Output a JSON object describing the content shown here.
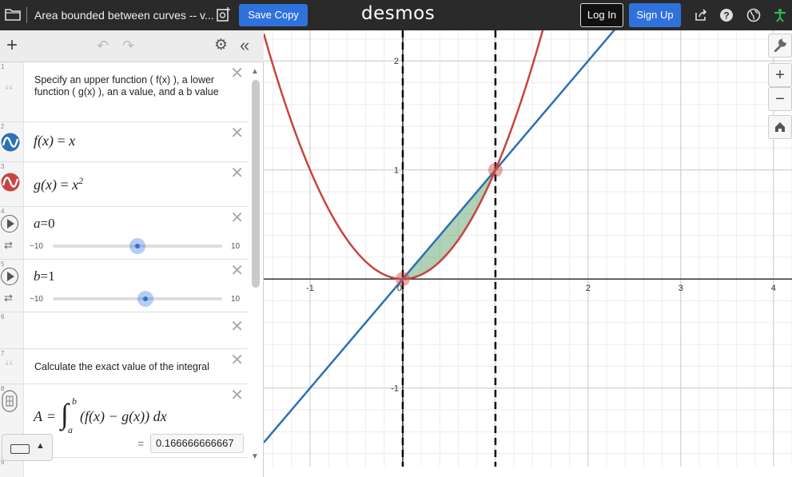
{
  "header": {
    "doc_title": "Area bounded between curves -- v...",
    "save_copy": "Save Copy",
    "logo": "desmos",
    "log_in": "Log In",
    "sign_up": "Sign Up",
    "icons": [
      "folder-icon",
      "new-doc-icon",
      "share-icon",
      "help-icon",
      "globe-icon",
      "accessibility-icon"
    ]
  },
  "toolbar": {
    "add": "+",
    "undo": "↶",
    "redo": "↷",
    "settings": "⚙",
    "collapse": "«"
  },
  "expressions": [
    {
      "index": "1",
      "type": "note",
      "text": "Specify an upper function ( f(x) ), a lower function ( g(x) ), an a value, and a b value"
    },
    {
      "index": "2",
      "type": "expression",
      "color": "#2d70b3",
      "lhs": "f(x)",
      "eq": "=",
      "rhs": "x"
    },
    {
      "index": "3",
      "type": "expression",
      "color": "#c74440",
      "lhs": "g(x)",
      "eq": "=",
      "rhs": "x",
      "exp": "2"
    },
    {
      "index": "4",
      "type": "slider",
      "lhs": "a",
      "eq": "=",
      "rhs": "0",
      "min": "−10",
      "max": "10",
      "value": 0
    },
    {
      "index": "5",
      "type": "slider",
      "lhs": "b",
      "eq": "=",
      "rhs": "1",
      "min": "−10",
      "max": "10",
      "value": 1
    },
    {
      "index": "6",
      "type": "empty"
    },
    {
      "index": "7",
      "type": "note",
      "text": "Calculate the exact value of the integral"
    },
    {
      "index": "8",
      "type": "integral",
      "lhs": "A",
      "upper": "b",
      "lower": "a",
      "body": "(f(x) − g(x)) dx",
      "result_eq": "=",
      "result": "0.166666666667"
    },
    {
      "index": "9",
      "type": "partial"
    }
  ],
  "graph": {
    "x_ticks": [
      "-1",
      "0",
      "2",
      "3",
      "4"
    ],
    "y_ticks": [
      "2",
      "1",
      "-1"
    ],
    "origin_label": "0",
    "curves": [
      {
        "name": "f(x) = x",
        "color": "#2d70b3"
      },
      {
        "name": "g(x) = x^2",
        "color": "#c74440"
      }
    ],
    "shade_color": "#388c46",
    "bounds": {
      "a": 0,
      "b": 1
    },
    "view": {
      "x_min": -1.5,
      "x_max": 4.2,
      "y_min": -1.72,
      "y_max": 2.28
    },
    "buttons": {
      "wrench": "wrench-icon",
      "zoom_in": "+",
      "zoom_out": "−",
      "home": "home-icon"
    }
  }
}
